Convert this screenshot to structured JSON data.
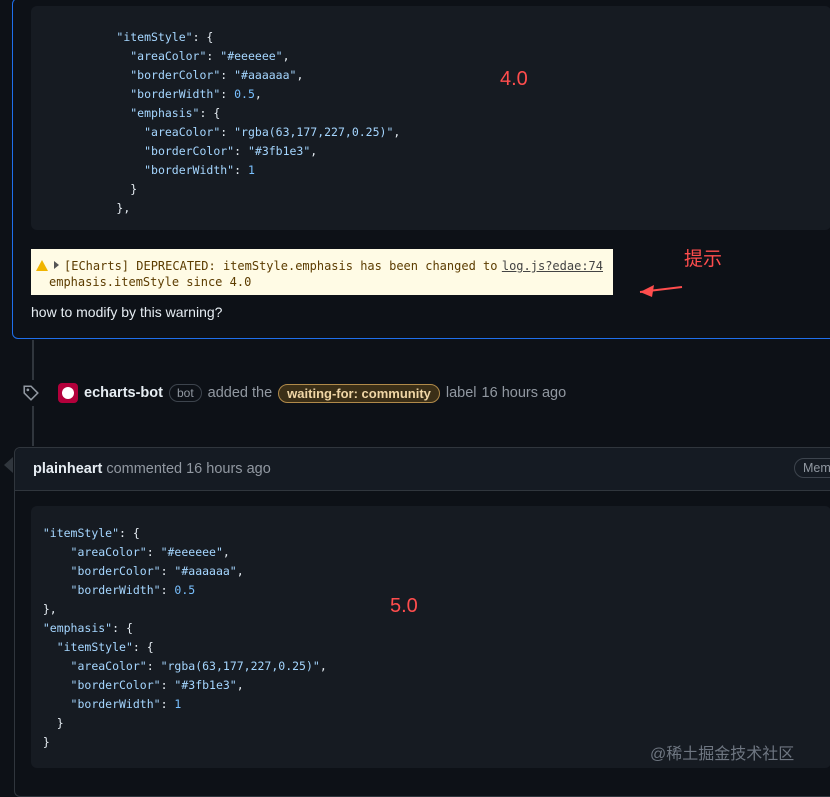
{
  "comment1": {
    "code_lines": [
      {
        "indent": "        ",
        "parts": [
          [
            "k",
            "\"itemStyle\""
          ],
          [
            "p",
            ": {"
          ]
        ]
      },
      {
        "indent": "          ",
        "parts": [
          [
            "k",
            "\"areaColor\""
          ],
          [
            "p",
            ": "
          ],
          [
            "s",
            "\"#eeeeee\""
          ],
          [
            "p",
            ","
          ]
        ]
      },
      {
        "indent": "          ",
        "parts": [
          [
            "k",
            "\"borderColor\""
          ],
          [
            "p",
            ": "
          ],
          [
            "s",
            "\"#aaaaaa\""
          ],
          [
            "p",
            ","
          ]
        ]
      },
      {
        "indent": "          ",
        "parts": [
          [
            "k",
            "\"borderWidth\""
          ],
          [
            "p",
            ": "
          ],
          [
            "n",
            "0.5"
          ],
          [
            "p",
            ","
          ]
        ]
      },
      {
        "indent": "          ",
        "parts": [
          [
            "k",
            "\"emphasis\""
          ],
          [
            "p",
            ": {"
          ]
        ]
      },
      {
        "indent": "            ",
        "parts": [
          [
            "k",
            "\"areaColor\""
          ],
          [
            "p",
            ": "
          ],
          [
            "s",
            "\"rgba(63,177,227,0.25)\""
          ],
          [
            "p",
            ","
          ]
        ]
      },
      {
        "indent": "            ",
        "parts": [
          [
            "k",
            "\"borderColor\""
          ],
          [
            "p",
            ": "
          ],
          [
            "s",
            "\"#3fb1e3\""
          ],
          [
            "p",
            ","
          ]
        ]
      },
      {
        "indent": "            ",
        "parts": [
          [
            "k",
            "\"borderWidth\""
          ],
          [
            "p",
            ": "
          ],
          [
            "n",
            "1"
          ]
        ]
      },
      {
        "indent": "          ",
        "parts": [
          [
            "p",
            "}"
          ]
        ]
      },
      {
        "indent": "        ",
        "parts": [
          [
            "p",
            "},"
          ]
        ]
      }
    ],
    "version_annotation": "4.0",
    "hint_annotation": "提示",
    "warning": {
      "line1": "[ECharts] DEPRECATED: itemStyle.emphasis has been changed to",
      "line2": "emphasis.itemStyle since 4.0",
      "source_link": "log.js?edae:74"
    },
    "question": "how to modify by this warning?"
  },
  "event": {
    "actor": "echarts-bot",
    "badge": "bot",
    "action": "added the",
    "label": "waiting-for: community",
    "suffix": "label",
    "time": "16 hours ago"
  },
  "comment2": {
    "author": "plainheart",
    "meta": "commented 16 hours ago",
    "role_badge": "Mem",
    "code_lines": [
      {
        "indent": "  ",
        "parts": [
          [
            "k",
            "\"itemStyle\""
          ],
          [
            "p",
            ": {"
          ]
        ]
      },
      {
        "indent": "      ",
        "parts": [
          [
            "k",
            "\"areaColor\""
          ],
          [
            "p",
            ": "
          ],
          [
            "s",
            "\"#eeeeee\""
          ],
          [
            "p",
            ","
          ]
        ]
      },
      {
        "indent": "      ",
        "parts": [
          [
            "k",
            "\"borderColor\""
          ],
          [
            "p",
            ": "
          ],
          [
            "s",
            "\"#aaaaaa\""
          ],
          [
            "p",
            ","
          ]
        ]
      },
      {
        "indent": "      ",
        "parts": [
          [
            "k",
            "\"borderWidth\""
          ],
          [
            "p",
            ": "
          ],
          [
            "n",
            "0.5"
          ]
        ]
      },
      {
        "indent": "  ",
        "parts": [
          [
            "p",
            "},"
          ]
        ]
      },
      {
        "indent": "  ",
        "parts": [
          [
            "k",
            "\"emphasis\""
          ],
          [
            "p",
            ": {"
          ]
        ]
      },
      {
        "indent": "    ",
        "parts": [
          [
            "k",
            "\"itemStyle\""
          ],
          [
            "p",
            ": {"
          ]
        ]
      },
      {
        "indent": "      ",
        "parts": [
          [
            "k",
            "\"areaColor\""
          ],
          [
            "p",
            ": "
          ],
          [
            "s",
            "\"rgba(63,177,227,0.25)\""
          ],
          [
            "p",
            ","
          ]
        ]
      },
      {
        "indent": "      ",
        "parts": [
          [
            "k",
            "\"borderColor\""
          ],
          [
            "p",
            ": "
          ],
          [
            "s",
            "\"#3fb1e3\""
          ],
          [
            "p",
            ","
          ]
        ]
      },
      {
        "indent": "      ",
        "parts": [
          [
            "k",
            "\"borderWidth\""
          ],
          [
            "p",
            ": "
          ],
          [
            "n",
            "1"
          ]
        ]
      },
      {
        "indent": "    ",
        "parts": [
          [
            "p",
            "}"
          ]
        ]
      },
      {
        "indent": "  ",
        "parts": [
          [
            "p",
            "}"
          ]
        ]
      }
    ],
    "version_annotation": "5.0"
  },
  "watermark": "@稀土掘金技术社区",
  "colors": {
    "annotation_red": "#ff4d4d",
    "label_border": "#b08a4a",
    "focus_border": "#1f6feb"
  }
}
